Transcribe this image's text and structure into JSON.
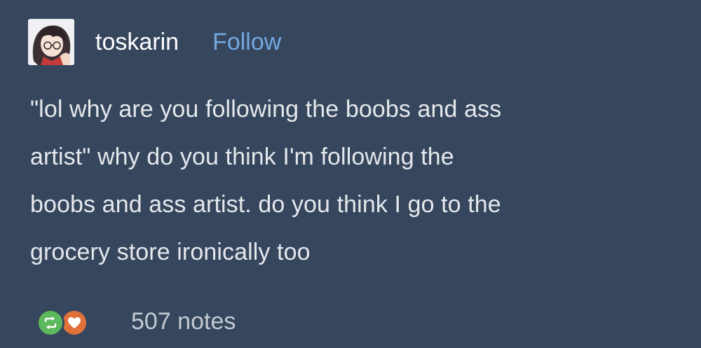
{
  "post": {
    "author": {
      "username": "toskarin",
      "follow_label": "Follow",
      "avatar_icon": "anime-character-avatar"
    },
    "body_lines": [
      "\"lol why are you following the boobs and ass",
      "artist\" why do you think I'm following the",
      "boobs and ass artist. do you think I go to the",
      "grocery store ironically too"
    ],
    "footer": {
      "reblog_icon": "reblog-icon",
      "like_icon": "heart-icon",
      "notes": "507 notes"
    }
  },
  "colors": {
    "background": "#36465d",
    "follow_link": "#74a9e0",
    "reblog_green": "#5cb85c",
    "like_orange": "#e0713a"
  }
}
